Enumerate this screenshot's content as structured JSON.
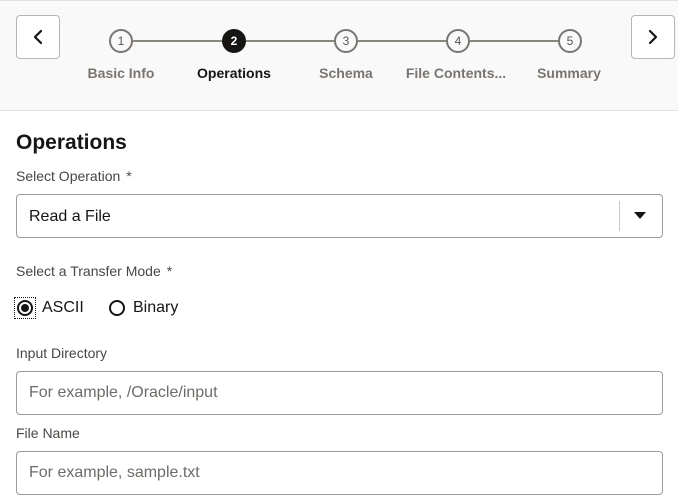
{
  "wizard": {
    "prev_icon": "chevron-left-icon",
    "next_icon": "chevron-right-icon",
    "steps": [
      {
        "number": "1",
        "label": "Basic Info",
        "state": "complete"
      },
      {
        "number": "2",
        "label": "Operations",
        "state": "active"
      },
      {
        "number": "3",
        "label": "Schema",
        "state": "pending"
      },
      {
        "number": "4",
        "label": "File Contents...",
        "state": "pending"
      },
      {
        "number": "5",
        "label": "Summary",
        "state": "pending"
      }
    ]
  },
  "form": {
    "title": "Operations",
    "operation": {
      "label": "Select Operation",
      "required_mark": "*",
      "value": "Read a File",
      "arrow_icon": "caret-down-icon"
    },
    "transfer_mode": {
      "label": "Select a Transfer Mode",
      "required_mark": "*",
      "options": [
        {
          "label": "ASCII",
          "selected": true
        },
        {
          "label": "Binary",
          "selected": false
        }
      ]
    },
    "input_directory": {
      "label": "Input Directory",
      "value": "",
      "placeholder": "For example, /Oracle/input"
    },
    "file_name": {
      "label": "File Name",
      "value": "",
      "placeholder": "For example, sample.txt"
    }
  },
  "colors": {
    "active_step": "#161513",
    "inactive_step": "#7a7570",
    "header_background": "#f9f9f9",
    "border": "#9e9a94"
  }
}
